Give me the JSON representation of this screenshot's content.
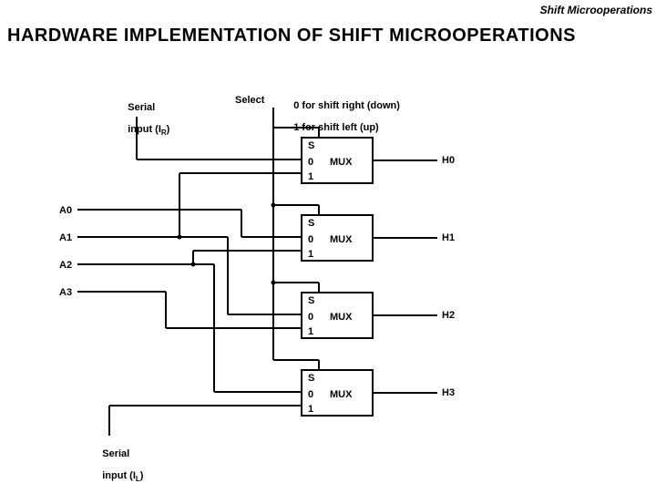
{
  "header": {
    "section": "Shift Microoperations",
    "title": "HARDWARE  IMPLEMENTATION  OF  SHIFT  MICROOPERATIONS"
  },
  "labels": {
    "serial_r1": "Serial",
    "serial_r2": "input (I",
    "serial_r_sub": "R",
    "serial_r3": ")",
    "select": "Select",
    "sel_line1": "0 for shift right (down)",
    "sel_line2": "1 for shift left (up)",
    "A0": "A0",
    "A1": "A1",
    "A2": "A2",
    "A3": "A3",
    "H0": "H0",
    "H1": "H1",
    "H2": "H2",
    "H3": "H3",
    "serial_l1": "Serial",
    "serial_l2": "input (I",
    "serial_l_sub": "L",
    "serial_l3": ")",
    "MUX": "MUX",
    "S": "S",
    "zero": "0",
    "one": "1"
  }
}
